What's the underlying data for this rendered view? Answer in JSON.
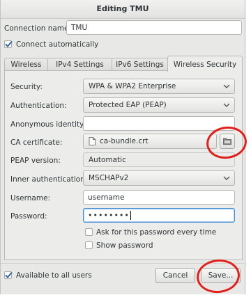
{
  "window": {
    "title": "Editing TMU"
  },
  "connection": {
    "name_label": "Connection name:",
    "name_value": "TMU",
    "connect_auto_label": "Connect automatically",
    "connect_auto_checked": true
  },
  "tabs": [
    {
      "label": "Wireless",
      "active": false
    },
    {
      "label": "IPv4 Settings",
      "active": false
    },
    {
      "label": "IPv6 Settings",
      "active": false
    },
    {
      "label": "Wireless Security",
      "active": true
    }
  ],
  "security_form": {
    "security_label": "Security:",
    "security_value": "WPA & WPA2 Enterprise",
    "authentication_label": "Authentication:",
    "authentication_value": "Protected EAP (PEAP)",
    "anonymous_identity_label": "Anonymous identity:",
    "anonymous_identity_value": "",
    "ca_certificate_label": "CA certificate:",
    "ca_certificate_value": "ca-bundle.crt",
    "peap_version_label": "PEAP version:",
    "peap_version_value": "Automatic",
    "inner_auth_label": "Inner authentication:",
    "inner_auth_value": "MSCHAPv2",
    "username_label": "Username:",
    "username_value": "username",
    "password_label": "Password:",
    "password_value": "••••••••",
    "ask_password_label": "Ask for this password every time",
    "ask_password_checked": false,
    "show_password_label": "Show password",
    "show_password_checked": false
  },
  "footer": {
    "available_all_users_label": "Available to all users",
    "available_all_users_checked": true,
    "cancel_label": "Cancel",
    "save_label": "Save..."
  },
  "colors": {
    "annotation_red": "#e0201c",
    "window_bg": "#e8e8e7"
  },
  "icons": {
    "file": "file-icon",
    "folder": "folder-icon",
    "dropdown": "chevron-down-icon",
    "check": "checkmark-icon"
  }
}
